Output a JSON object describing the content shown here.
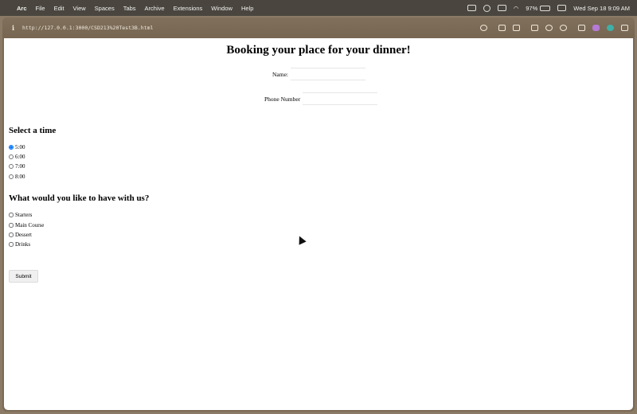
{
  "menubar": {
    "app_name": "Arc",
    "items": [
      "File",
      "Edit",
      "View",
      "Spaces",
      "Tabs",
      "Archive",
      "Extensions",
      "Window",
      "Help"
    ],
    "battery_percent": "97%",
    "datetime": "Wed Sep 18  9:09 AM"
  },
  "browser": {
    "url": "http://127.0.0.1:3000/CSD213%20Test3B.html"
  },
  "page": {
    "title": "Booking your place for your dinner!",
    "name_label": "Name:",
    "name_value": "",
    "phone_label": "Phone Number",
    "phone_value": "",
    "time_heading": "Select a time",
    "times": [
      {
        "label": "5:00",
        "checked": true
      },
      {
        "label": "6:00",
        "checked": false
      },
      {
        "label": "7:00",
        "checked": false
      },
      {
        "label": "8:00",
        "checked": false
      }
    ],
    "food_heading": "What would you like to have with us?",
    "foods": [
      {
        "label": "Starters",
        "checked": false
      },
      {
        "label": "Main Course",
        "checked": false
      },
      {
        "label": "Dessert",
        "checked": false
      },
      {
        "label": "Drinks",
        "checked": false
      }
    ],
    "submit_label": "Submit"
  },
  "colors": {
    "menubar_bg": "#4a463f",
    "toolbar_bg": "#7b6a55",
    "page_bg": "#ffffff"
  }
}
